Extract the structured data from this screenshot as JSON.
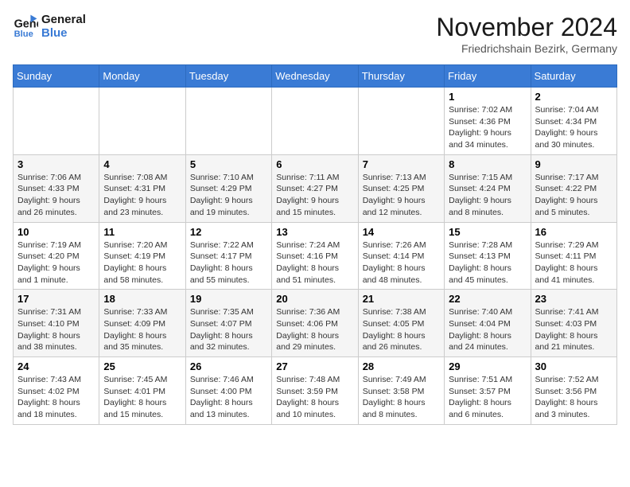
{
  "logo": {
    "line1": "General",
    "line2": "Blue"
  },
  "title": "November 2024",
  "subtitle": "Friedrichshain Bezirk, Germany",
  "weekdays": [
    "Sunday",
    "Monday",
    "Tuesday",
    "Wednesday",
    "Thursday",
    "Friday",
    "Saturday"
  ],
  "weeks": [
    [
      {
        "day": "",
        "info": ""
      },
      {
        "day": "",
        "info": ""
      },
      {
        "day": "",
        "info": ""
      },
      {
        "day": "",
        "info": ""
      },
      {
        "day": "",
        "info": ""
      },
      {
        "day": "1",
        "info": "Sunrise: 7:02 AM\nSunset: 4:36 PM\nDaylight: 9 hours and 34 minutes."
      },
      {
        "day": "2",
        "info": "Sunrise: 7:04 AM\nSunset: 4:34 PM\nDaylight: 9 hours and 30 minutes."
      }
    ],
    [
      {
        "day": "3",
        "info": "Sunrise: 7:06 AM\nSunset: 4:33 PM\nDaylight: 9 hours and 26 minutes."
      },
      {
        "day": "4",
        "info": "Sunrise: 7:08 AM\nSunset: 4:31 PM\nDaylight: 9 hours and 23 minutes."
      },
      {
        "day": "5",
        "info": "Sunrise: 7:10 AM\nSunset: 4:29 PM\nDaylight: 9 hours and 19 minutes."
      },
      {
        "day": "6",
        "info": "Sunrise: 7:11 AM\nSunset: 4:27 PM\nDaylight: 9 hours and 15 minutes."
      },
      {
        "day": "7",
        "info": "Sunrise: 7:13 AM\nSunset: 4:25 PM\nDaylight: 9 hours and 12 minutes."
      },
      {
        "day": "8",
        "info": "Sunrise: 7:15 AM\nSunset: 4:24 PM\nDaylight: 9 hours and 8 minutes."
      },
      {
        "day": "9",
        "info": "Sunrise: 7:17 AM\nSunset: 4:22 PM\nDaylight: 9 hours and 5 minutes."
      }
    ],
    [
      {
        "day": "10",
        "info": "Sunrise: 7:19 AM\nSunset: 4:20 PM\nDaylight: 9 hours and 1 minute."
      },
      {
        "day": "11",
        "info": "Sunrise: 7:20 AM\nSunset: 4:19 PM\nDaylight: 8 hours and 58 minutes."
      },
      {
        "day": "12",
        "info": "Sunrise: 7:22 AM\nSunset: 4:17 PM\nDaylight: 8 hours and 55 minutes."
      },
      {
        "day": "13",
        "info": "Sunrise: 7:24 AM\nSunset: 4:16 PM\nDaylight: 8 hours and 51 minutes."
      },
      {
        "day": "14",
        "info": "Sunrise: 7:26 AM\nSunset: 4:14 PM\nDaylight: 8 hours and 48 minutes."
      },
      {
        "day": "15",
        "info": "Sunrise: 7:28 AM\nSunset: 4:13 PM\nDaylight: 8 hours and 45 minutes."
      },
      {
        "day": "16",
        "info": "Sunrise: 7:29 AM\nSunset: 4:11 PM\nDaylight: 8 hours and 41 minutes."
      }
    ],
    [
      {
        "day": "17",
        "info": "Sunrise: 7:31 AM\nSunset: 4:10 PM\nDaylight: 8 hours and 38 minutes."
      },
      {
        "day": "18",
        "info": "Sunrise: 7:33 AM\nSunset: 4:09 PM\nDaylight: 8 hours and 35 minutes."
      },
      {
        "day": "19",
        "info": "Sunrise: 7:35 AM\nSunset: 4:07 PM\nDaylight: 8 hours and 32 minutes."
      },
      {
        "day": "20",
        "info": "Sunrise: 7:36 AM\nSunset: 4:06 PM\nDaylight: 8 hours and 29 minutes."
      },
      {
        "day": "21",
        "info": "Sunrise: 7:38 AM\nSunset: 4:05 PM\nDaylight: 8 hours and 26 minutes."
      },
      {
        "day": "22",
        "info": "Sunrise: 7:40 AM\nSunset: 4:04 PM\nDaylight: 8 hours and 24 minutes."
      },
      {
        "day": "23",
        "info": "Sunrise: 7:41 AM\nSunset: 4:03 PM\nDaylight: 8 hours and 21 minutes."
      }
    ],
    [
      {
        "day": "24",
        "info": "Sunrise: 7:43 AM\nSunset: 4:02 PM\nDaylight: 8 hours and 18 minutes."
      },
      {
        "day": "25",
        "info": "Sunrise: 7:45 AM\nSunset: 4:01 PM\nDaylight: 8 hours and 15 minutes."
      },
      {
        "day": "26",
        "info": "Sunrise: 7:46 AM\nSunset: 4:00 PM\nDaylight: 8 hours and 13 minutes."
      },
      {
        "day": "27",
        "info": "Sunrise: 7:48 AM\nSunset: 3:59 PM\nDaylight: 8 hours and 10 minutes."
      },
      {
        "day": "28",
        "info": "Sunrise: 7:49 AM\nSunset: 3:58 PM\nDaylight: 8 hours and 8 minutes."
      },
      {
        "day": "29",
        "info": "Sunrise: 7:51 AM\nSunset: 3:57 PM\nDaylight: 8 hours and 6 minutes."
      },
      {
        "day": "30",
        "info": "Sunrise: 7:52 AM\nSunset: 3:56 PM\nDaylight: 8 hours and 3 minutes."
      }
    ]
  ]
}
